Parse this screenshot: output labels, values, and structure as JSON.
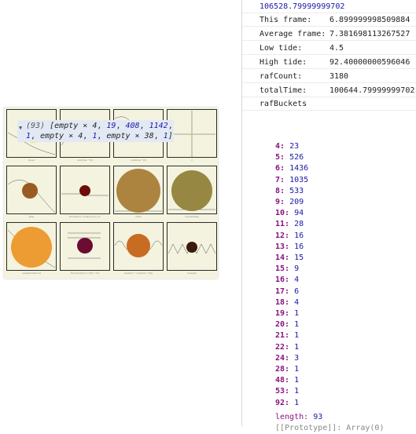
{
  "stats": [
    {
      "key": "",
      "value": "106528.79999999702"
    },
    {
      "key": "This frame:",
      "value": "6.899999998509884"
    },
    {
      "key": "Average frame:",
      "value": "7.381698113267527"
    },
    {
      "key": "Low tide:",
      "value": "4.5"
    },
    {
      "key": "High tide:",
      "value": "92.40000000596046"
    },
    {
      "key": "rafCount:",
      "value": "3180"
    },
    {
      "key": "totalTime:",
      "value": "100644.79999999702"
    },
    {
      "key": "rafBuckets",
      "value": ""
    }
  ],
  "array_summary": {
    "count": "(93)",
    "open": "[",
    "item_a": "empty × 4",
    "item_b": "19",
    "item_c": "408",
    "item_d": "1142",
    "item_e": "1",
    "item_f": "empty × 4",
    "item_g": "1",
    "item_h": "empty × 38",
    "item_i": "1",
    "close": "]"
  },
  "buckets": [
    {
      "k": "4:",
      "v": "23"
    },
    {
      "k": "5:",
      "v": "526"
    },
    {
      "k": "6:",
      "v": "1436"
    },
    {
      "k": "7:",
      "v": "1035"
    },
    {
      "k": "8:",
      "v": "533"
    },
    {
      "k": "9:",
      "v": "209"
    },
    {
      "k": "10:",
      "v": "94"
    },
    {
      "k": "11:",
      "v": "28"
    },
    {
      "k": "12:",
      "v": "16"
    },
    {
      "k": "13:",
      "v": "16"
    },
    {
      "k": "14:",
      "v": "15"
    },
    {
      "k": "15:",
      "v": "9"
    },
    {
      "k": "16:",
      "v": "4"
    },
    {
      "k": "17:",
      "v": "6"
    },
    {
      "k": "18:",
      "v": "4"
    },
    {
      "k": "19:",
      "v": "1"
    },
    {
      "k": "20:",
      "v": "1"
    },
    {
      "k": "21:",
      "v": "1"
    },
    {
      "k": "22:",
      "v": "1"
    },
    {
      "k": "24:",
      "v": "3"
    },
    {
      "k": "28:",
      "v": "1"
    },
    {
      "k": "48:",
      "v": "1"
    },
    {
      "k": "53:",
      "v": "1"
    },
    {
      "k": "92:",
      "v": "1"
    }
  ],
  "length": {
    "k": "length:",
    "v": "93"
  },
  "proto": "[[Prototype]]: Array(0)",
  "grid": {
    "background": "#f4f3df",
    "cells": [
      {
        "caption": "linear",
        "color": "#f2e553"
      },
      {
        "caption": "sin(time * PI)",
        "color": "#5e1e0c"
      },
      {
        "caption": "cos(time * PI) ",
        "color": "#7b0a1c"
      },
      {
        "caption": "x",
        "color": "#f2c244"
      },
      {
        "caption": "step",
        "color": "#9a5b22"
      },
      {
        "caption": "floor(time * frequency) / fr",
        "color": "#6e0b0b"
      },
      {
        "caption": "fract",
        "color": "#ad8340"
      },
      {
        "caption": "smoothstep",
        "color": "#968743"
      },
      {
        "caption": "easeInOutQuad",
        "color": "#ed9c33"
      },
      {
        "caption": "floor(sin(time * PI)) * 0.5",
        "color": "#6b0c33"
      },
      {
        "caption": "sin(time * sin(time * PI))",
        "color": "#c76c22"
      },
      {
        "caption": "triangle",
        "color": "#3c1a0b"
      }
    ]
  }
}
